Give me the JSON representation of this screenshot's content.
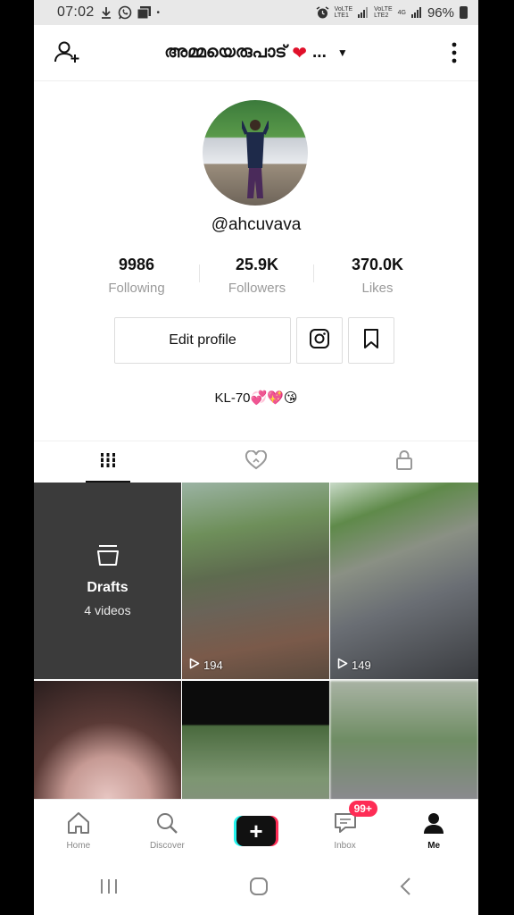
{
  "status_bar": {
    "time": "07:02",
    "battery": "96%",
    "lte1": "LTE1",
    "lte2": "LTE2",
    "net": "4G"
  },
  "header": {
    "title": "അമ്മയെരുപാട്",
    "ellipsis": "..."
  },
  "profile": {
    "handle": "@ahcuvava",
    "stats": [
      {
        "value": "9986",
        "label": "Following"
      },
      {
        "value": "25.9K",
        "label": "Followers"
      },
      {
        "value": "370.0K",
        "label": "Likes"
      }
    ],
    "edit_label": "Edit profile",
    "bio": "KL-70💞💖😘"
  },
  "grid": {
    "drafts_title": "Drafts",
    "drafts_count": "4 videos",
    "videos": [
      {
        "views": "194"
      },
      {
        "views": "149"
      },
      {
        "views": ""
      },
      {
        "views": ""
      },
      {
        "views": ""
      }
    ]
  },
  "bottom_nav": {
    "items": [
      {
        "label": "Home"
      },
      {
        "label": "Discover"
      },
      {
        "label": "Inbox"
      },
      {
        "label": "Me"
      }
    ],
    "inbox_badge": "99+"
  },
  "colors": {
    "accent": "#fe2c55",
    "accent2": "#25f4ee",
    "drafts_bg": "#3b3b3b"
  }
}
